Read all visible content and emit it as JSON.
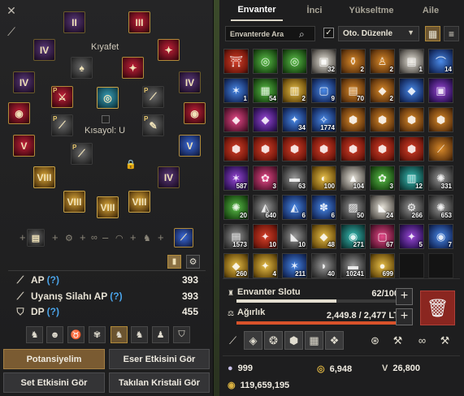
{
  "equipment": {
    "costume_label": "Kıyafet",
    "shortcut_label": "Kısayol: U",
    "slots": [
      {
        "name": "helmet-slot",
        "style": "purple",
        "roman": "II"
      },
      {
        "name": "earring-slot",
        "style": "red",
        "roman": "III"
      },
      {
        "name": "belt-slot-left",
        "style": "purple",
        "roman": "IV"
      },
      {
        "name": "ring-slot-right",
        "style": "red",
        "roman": "IV"
      },
      {
        "name": "necklace-slot",
        "style": "purple",
        "roman": "IV"
      },
      {
        "name": "ring-slot-2",
        "style": "purple",
        "roman": "IV"
      },
      {
        "name": "main-weapon-slot",
        "style": "red",
        "roman": "V"
      },
      {
        "name": "offhand-slot",
        "style": "blue",
        "roman": "V"
      },
      {
        "name": "armor-slot",
        "style": "gold",
        "roman": "VIII"
      },
      {
        "name": "glove-slot",
        "style": "gold",
        "roman": "IV"
      },
      {
        "name": "shoe-slot-left",
        "style": "gold",
        "roman": "VIII"
      },
      {
        "name": "awakening-slot",
        "style": "gold",
        "roman": "VIII"
      },
      {
        "name": "shoe-slot-right",
        "style": "gold",
        "roman": "VIII"
      }
    ],
    "stats": [
      {
        "label": "AP",
        "help": "(?)",
        "value": "393"
      },
      {
        "label": "Uyanış Silahı AP",
        "help": "(?)",
        "value": "393"
      },
      {
        "label": "DP",
        "help": "(?)",
        "value": "455"
      }
    ],
    "buttons": {
      "potential": "Potansiyelim",
      "item_effect": "Eser Etkisini Gör",
      "set_effect": "Set Etkisini Gör",
      "crystal": "Takılan Kristali Gör"
    }
  },
  "inventory": {
    "tabs": [
      "Envanter",
      "İnci",
      "Yükseltme",
      "Aile"
    ],
    "search_placeholder": "Envanterde Ara",
    "auto_sort": "Oto. Düzenle",
    "auto_sort_checked": true,
    "items": [
      {
        "c": "red",
        "i": "⛩",
        "n": ""
      },
      {
        "c": "green",
        "i": "◎",
        "n": ""
      },
      {
        "c": "green",
        "i": "◎",
        "n": ""
      },
      {
        "c": "white",
        "i": "▣",
        "n": "32"
      },
      {
        "c": "orange",
        "i": "⚱",
        "n": "2"
      },
      {
        "c": "orange",
        "i": "♙",
        "n": "2"
      },
      {
        "c": "white",
        "i": "▤",
        "n": "1"
      },
      {
        "c": "blue",
        "i": "⌒",
        "n": "14"
      },
      {
        "c": "blue",
        "i": "✶",
        "n": "1"
      },
      {
        "c": "green",
        "i": "▦",
        "n": "54"
      },
      {
        "c": "gold",
        "i": "▥",
        "n": "2"
      },
      {
        "c": "blue",
        "i": "▢",
        "n": "9"
      },
      {
        "c": "orange",
        "i": "▤",
        "n": "70"
      },
      {
        "c": "orange",
        "i": "◆",
        "n": "2"
      },
      {
        "c": "blue",
        "i": "◆",
        "n": ""
      },
      {
        "c": "purple",
        "i": "▣",
        "n": ""
      },
      {
        "c": "pink",
        "i": "◆",
        "n": ""
      },
      {
        "c": "purple",
        "i": "◆",
        "n": ""
      },
      {
        "c": "blue",
        "i": "✦",
        "n": "34"
      },
      {
        "c": "blue",
        "i": "✧",
        "n": "1774"
      },
      {
        "c": "orange",
        "i": "⬢",
        "n": ""
      },
      {
        "c": "orange",
        "i": "⬢",
        "n": ""
      },
      {
        "c": "orange",
        "i": "⬢",
        "n": ""
      },
      {
        "c": "orange",
        "i": "⬢",
        "n": ""
      },
      {
        "c": "red",
        "i": "⬢",
        "n": ""
      },
      {
        "c": "red",
        "i": "⬢",
        "n": ""
      },
      {
        "c": "red",
        "i": "⬢",
        "n": ""
      },
      {
        "c": "red",
        "i": "⬢",
        "n": ""
      },
      {
        "c": "red",
        "i": "⬢",
        "n": ""
      },
      {
        "c": "red",
        "i": "⬢",
        "n": ""
      },
      {
        "c": "red",
        "i": "⬢",
        "n": ""
      },
      {
        "c": "orange",
        "i": "⟋",
        "n": ""
      },
      {
        "c": "purple",
        "i": "✶",
        "n": "587"
      },
      {
        "c": "pink",
        "i": "✿",
        "n": "3"
      },
      {
        "c": "gray",
        "i": "▬",
        "n": "63"
      },
      {
        "c": "gold",
        "i": "◐",
        "n": "100"
      },
      {
        "c": "white",
        "i": "▲",
        "n": "104"
      },
      {
        "c": "green",
        "i": "✿",
        "n": "3"
      },
      {
        "c": "teal",
        "i": "▥",
        "n": "12"
      },
      {
        "c": "gray",
        "i": "✺",
        "n": "331"
      },
      {
        "c": "green",
        "i": "✺",
        "n": "20"
      },
      {
        "c": "gray",
        "i": "◭",
        "n": "640"
      },
      {
        "c": "blue",
        "i": "◭",
        "n": "6"
      },
      {
        "c": "blue",
        "i": "✽",
        "n": "6"
      },
      {
        "c": "gray",
        "i": "▨",
        "n": "50"
      },
      {
        "c": "white",
        "i": "◣",
        "n": "24"
      },
      {
        "c": "gray",
        "i": "⚙",
        "n": "266"
      },
      {
        "c": "gray",
        "i": "✺",
        "n": "653"
      },
      {
        "c": "gray",
        "i": "▤",
        "n": "1573"
      },
      {
        "c": "red",
        "i": "✦",
        "n": "10"
      },
      {
        "c": "gray",
        "i": "◣",
        "n": "10"
      },
      {
        "c": "gold",
        "i": "◆",
        "n": "48"
      },
      {
        "c": "teal",
        "i": "◉",
        "n": "271"
      },
      {
        "c": "pink",
        "i": "▢",
        "n": "67"
      },
      {
        "c": "purple",
        "i": "✦",
        "n": "5"
      },
      {
        "c": "blue",
        "i": "◉",
        "n": "7"
      },
      {
        "c": "gold",
        "i": "◆",
        "n": "260"
      },
      {
        "c": "gold",
        "i": "✦",
        "n": "4"
      },
      {
        "c": "blue",
        "i": "✶",
        "n": "211"
      },
      {
        "c": "gray",
        "i": "◗",
        "n": "40"
      },
      {
        "c": "gray",
        "i": "▬",
        "n": "10241"
      },
      {
        "c": "gold",
        "i": "●",
        "n": "699"
      },
      {
        "c": "empty",
        "i": "",
        "n": ""
      },
      {
        "c": "empty",
        "i": "",
        "n": ""
      }
    ],
    "slot_label": "Envanter Slotu",
    "slot_value": "62/100",
    "slot_fraction": 0.62,
    "weight_label": "Ağırlık",
    "weight_value": "2,449.8 / 2,477 LT",
    "weight_fraction": 0.989,
    "silver_label": "999",
    "gold_value": "6,948",
    "v_value": "26,800",
    "money_value": "119,659,195",
    "colors": {
      "slot_bar": "#e4dfd0",
      "weight_bar": "#d8522a",
      "accent": "#b08a3a"
    }
  }
}
